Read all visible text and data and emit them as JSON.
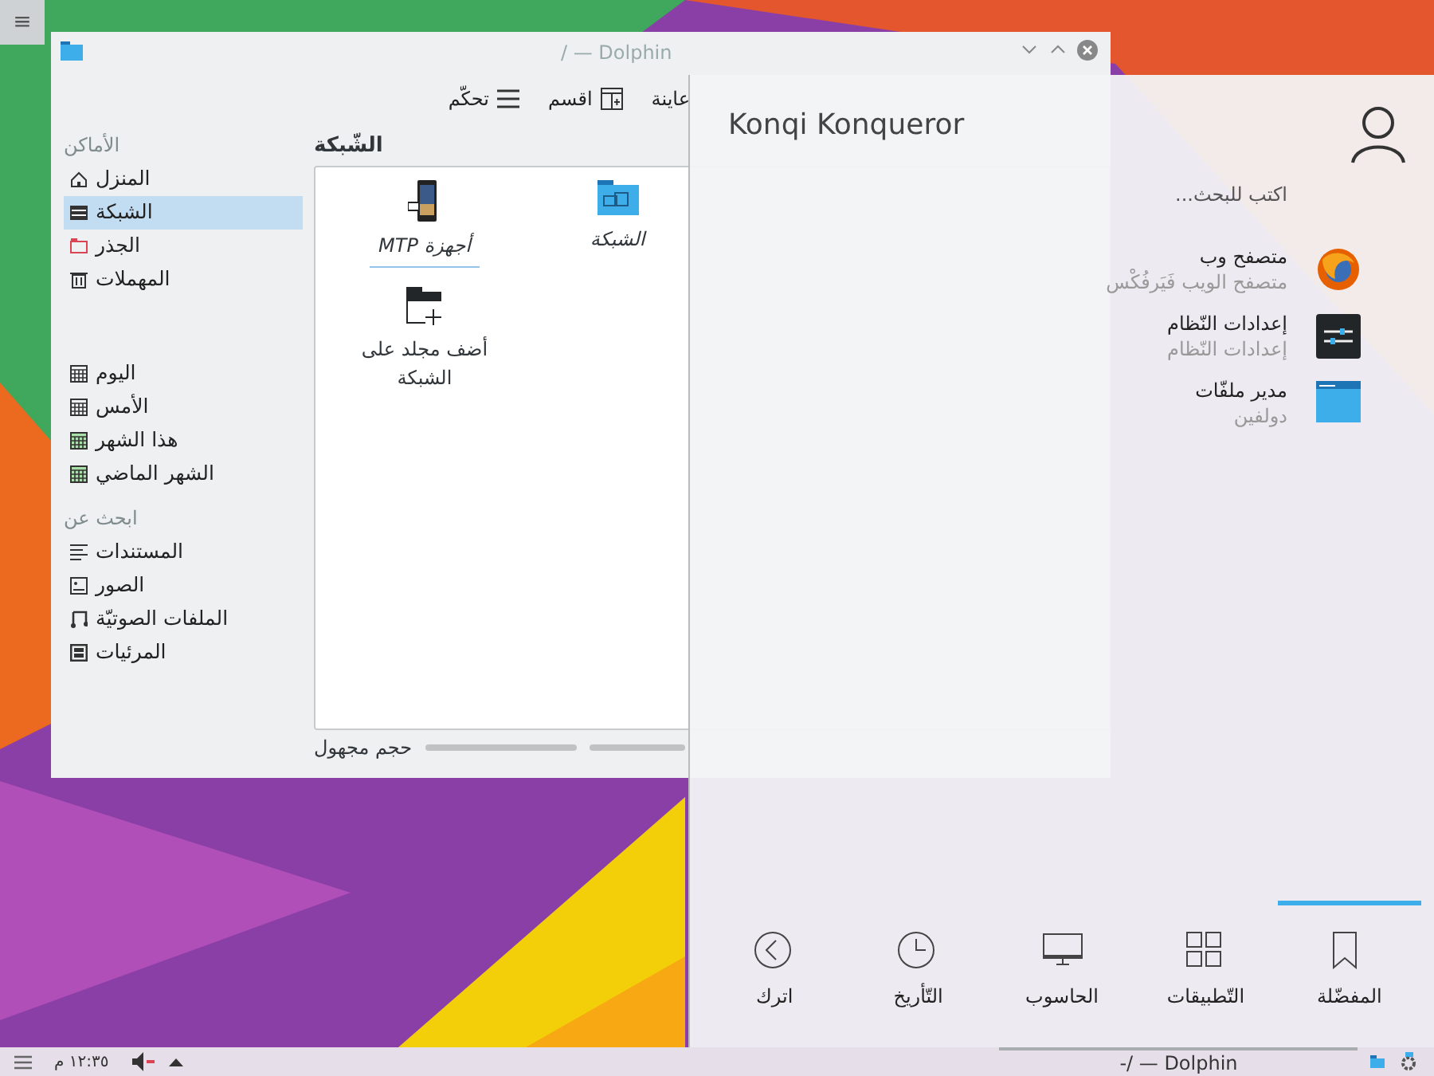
{
  "desktop": {
    "toolbox_icon": "≡"
  },
  "dolphin": {
    "title": "/ — Dolphin",
    "toolbar": [
      {
        "label": "عاينة",
        "kind": "none"
      },
      {
        "label": "اقسم",
        "kind": "split"
      },
      {
        "label": "تحكّم",
        "kind": "menu"
      }
    ],
    "sidebar": [
      {
        "heading": "الأماكن",
        "items": [
          {
            "label": "المنزل",
            "kind": "home",
            "selected": false
          },
          {
            "label": "الشبكة",
            "kind": "network",
            "selected": true
          },
          {
            "label": "الجذر",
            "kind": "root",
            "selected": false
          },
          {
            "label": "المهملات",
            "kind": "trash",
            "selected": false
          }
        ]
      },
      {
        "items": [
          {
            "label": "اليوم",
            "kind": "calendar",
            "selected": false
          },
          {
            "label": "الأمس",
            "kind": "calendar",
            "selected": false
          },
          {
            "label": "هذا الشهر",
            "kind": "calendar-green",
            "selected": false
          },
          {
            "label": "الشهر الماضي",
            "kind": "calendar-green",
            "selected": false
          }
        ]
      },
      {
        "heading": "ابحث عن",
        "items": [
          {
            "label": "المستندات",
            "kind": "documents",
            "selected": false
          },
          {
            "label": "الصور",
            "kind": "images",
            "selected": false
          },
          {
            "label": "الملفات الصوتيّة",
            "kind": "audio",
            "selected": false
          },
          {
            "label": "المرئيات",
            "kind": "video",
            "selected": false
          }
        ]
      }
    ],
    "location": "الشّبكة",
    "items": [
      {
        "label": "الشبكة",
        "kind": "network-folder",
        "focused": false
      },
      {
        "label": "أجهزة MTP",
        "kind": "phone",
        "focused": true
      },
      {
        "label": "أضف مجلد على الشبكة",
        "kind": "add-folder",
        "focused": false
      }
    ],
    "status": "حجم مجهول"
  },
  "launcher": {
    "user": "Konqi Konqueror",
    "search": {
      "placeholder": "اكتب للبحث..."
    },
    "favorites": [
      {
        "name": "متصفح وب",
        "subtitle": "متصفح الويب فَيَرفُكْس",
        "kind": "browser"
      },
      {
        "name": "إعدادات النّظام",
        "subtitle": "إعدادات النّظام",
        "kind": "settings"
      },
      {
        "name": "مدير ملفّات",
        "subtitle": "دولفين",
        "kind": "folder"
      }
    ],
    "tabs": [
      {
        "label": "المفضّلة",
        "kind": "bookmark",
        "selected": true
      },
      {
        "label": "التّطبيقات",
        "kind": "apps",
        "selected": false
      },
      {
        "label": "الحاسوب",
        "kind": "computer",
        "selected": false
      },
      {
        "label": "التّأريخ",
        "kind": "history",
        "selected": false
      },
      {
        "label": "اترك",
        "kind": "leave",
        "selected": false
      }
    ]
  },
  "taskbar": {
    "clock": "١٢:٣٥ م",
    "task": "-/ — Dolphin"
  }
}
